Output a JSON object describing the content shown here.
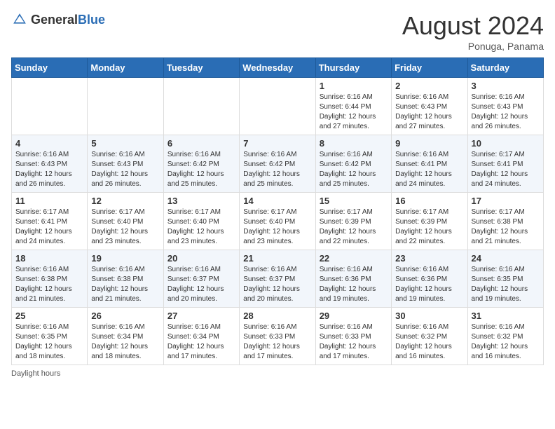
{
  "header": {
    "logo_general": "General",
    "logo_blue": "Blue",
    "month_year": "August 2024",
    "location": "Ponuga, Panama"
  },
  "days_of_week": [
    "Sunday",
    "Monday",
    "Tuesday",
    "Wednesday",
    "Thursday",
    "Friday",
    "Saturday"
  ],
  "weeks": [
    [
      {
        "day": "",
        "info": ""
      },
      {
        "day": "",
        "info": ""
      },
      {
        "day": "",
        "info": ""
      },
      {
        "day": "",
        "info": ""
      },
      {
        "day": "1",
        "info": "Sunrise: 6:16 AM\nSunset: 6:44 PM\nDaylight: 12 hours\nand 27 minutes."
      },
      {
        "day": "2",
        "info": "Sunrise: 6:16 AM\nSunset: 6:43 PM\nDaylight: 12 hours\nand 27 minutes."
      },
      {
        "day": "3",
        "info": "Sunrise: 6:16 AM\nSunset: 6:43 PM\nDaylight: 12 hours\nand 26 minutes."
      }
    ],
    [
      {
        "day": "4",
        "info": "Sunrise: 6:16 AM\nSunset: 6:43 PM\nDaylight: 12 hours\nand 26 minutes."
      },
      {
        "day": "5",
        "info": "Sunrise: 6:16 AM\nSunset: 6:43 PM\nDaylight: 12 hours\nand 26 minutes."
      },
      {
        "day": "6",
        "info": "Sunrise: 6:16 AM\nSunset: 6:42 PM\nDaylight: 12 hours\nand 25 minutes."
      },
      {
        "day": "7",
        "info": "Sunrise: 6:16 AM\nSunset: 6:42 PM\nDaylight: 12 hours\nand 25 minutes."
      },
      {
        "day": "8",
        "info": "Sunrise: 6:16 AM\nSunset: 6:42 PM\nDaylight: 12 hours\nand 25 minutes."
      },
      {
        "day": "9",
        "info": "Sunrise: 6:16 AM\nSunset: 6:41 PM\nDaylight: 12 hours\nand 24 minutes."
      },
      {
        "day": "10",
        "info": "Sunrise: 6:17 AM\nSunset: 6:41 PM\nDaylight: 12 hours\nand 24 minutes."
      }
    ],
    [
      {
        "day": "11",
        "info": "Sunrise: 6:17 AM\nSunset: 6:41 PM\nDaylight: 12 hours\nand 24 minutes."
      },
      {
        "day": "12",
        "info": "Sunrise: 6:17 AM\nSunset: 6:40 PM\nDaylight: 12 hours\nand 23 minutes."
      },
      {
        "day": "13",
        "info": "Sunrise: 6:17 AM\nSunset: 6:40 PM\nDaylight: 12 hours\nand 23 minutes."
      },
      {
        "day": "14",
        "info": "Sunrise: 6:17 AM\nSunset: 6:40 PM\nDaylight: 12 hours\nand 23 minutes."
      },
      {
        "day": "15",
        "info": "Sunrise: 6:17 AM\nSunset: 6:39 PM\nDaylight: 12 hours\nand 22 minutes."
      },
      {
        "day": "16",
        "info": "Sunrise: 6:17 AM\nSunset: 6:39 PM\nDaylight: 12 hours\nand 22 minutes."
      },
      {
        "day": "17",
        "info": "Sunrise: 6:17 AM\nSunset: 6:38 PM\nDaylight: 12 hours\nand 21 minutes."
      }
    ],
    [
      {
        "day": "18",
        "info": "Sunrise: 6:16 AM\nSunset: 6:38 PM\nDaylight: 12 hours\nand 21 minutes."
      },
      {
        "day": "19",
        "info": "Sunrise: 6:16 AM\nSunset: 6:38 PM\nDaylight: 12 hours\nand 21 minutes."
      },
      {
        "day": "20",
        "info": "Sunrise: 6:16 AM\nSunset: 6:37 PM\nDaylight: 12 hours\nand 20 minutes."
      },
      {
        "day": "21",
        "info": "Sunrise: 6:16 AM\nSunset: 6:37 PM\nDaylight: 12 hours\nand 20 minutes."
      },
      {
        "day": "22",
        "info": "Sunrise: 6:16 AM\nSunset: 6:36 PM\nDaylight: 12 hours\nand 19 minutes."
      },
      {
        "day": "23",
        "info": "Sunrise: 6:16 AM\nSunset: 6:36 PM\nDaylight: 12 hours\nand 19 minutes."
      },
      {
        "day": "24",
        "info": "Sunrise: 6:16 AM\nSunset: 6:35 PM\nDaylight: 12 hours\nand 19 minutes."
      }
    ],
    [
      {
        "day": "25",
        "info": "Sunrise: 6:16 AM\nSunset: 6:35 PM\nDaylight: 12 hours\nand 18 minutes."
      },
      {
        "day": "26",
        "info": "Sunrise: 6:16 AM\nSunset: 6:34 PM\nDaylight: 12 hours\nand 18 minutes."
      },
      {
        "day": "27",
        "info": "Sunrise: 6:16 AM\nSunset: 6:34 PM\nDaylight: 12 hours\nand 17 minutes."
      },
      {
        "day": "28",
        "info": "Sunrise: 6:16 AM\nSunset: 6:33 PM\nDaylight: 12 hours\nand 17 minutes."
      },
      {
        "day": "29",
        "info": "Sunrise: 6:16 AM\nSunset: 6:33 PM\nDaylight: 12 hours\nand 17 minutes."
      },
      {
        "day": "30",
        "info": "Sunrise: 6:16 AM\nSunset: 6:32 PM\nDaylight: 12 hours\nand 16 minutes."
      },
      {
        "day": "31",
        "info": "Sunrise: 6:16 AM\nSunset: 6:32 PM\nDaylight: 12 hours\nand 16 minutes."
      }
    ]
  ],
  "footer": {
    "note": "Daylight hours"
  }
}
